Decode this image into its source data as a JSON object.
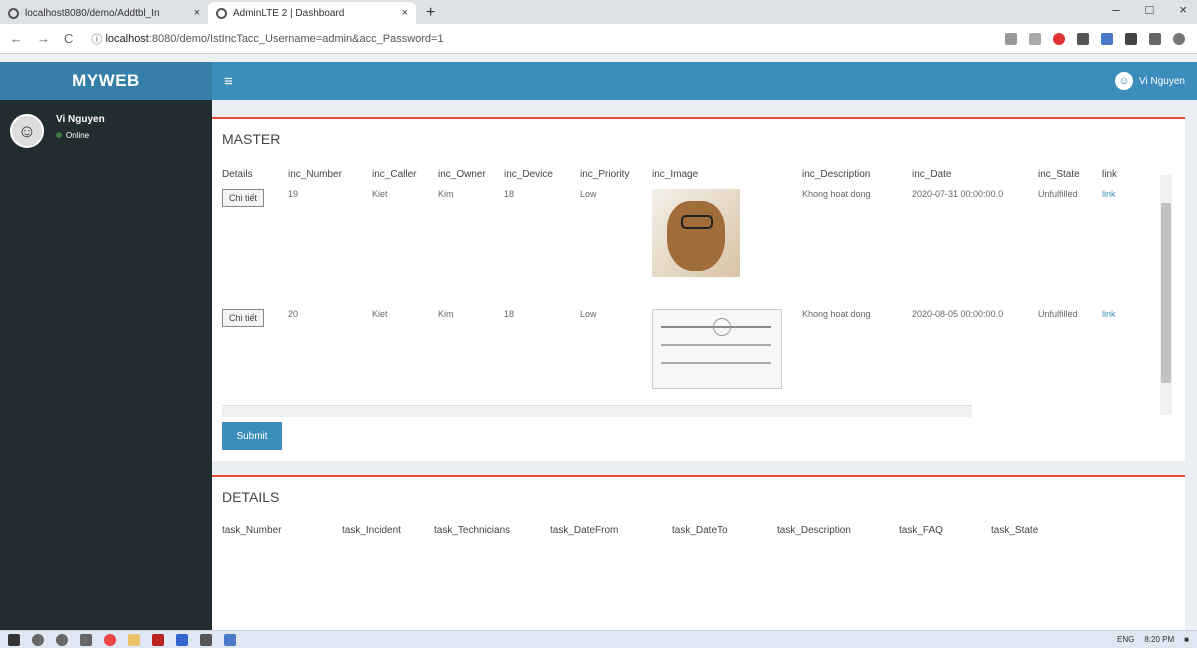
{
  "browser": {
    "tabs": [
      {
        "title": "localhost8080/demo/Addtbl_In"
      },
      {
        "title": "AdminLTE 2 | Dashboard"
      }
    ],
    "url_host": "localhost",
    "url_path": ":8080/demo/IstIncTacc_Username=admin&acc_Password=1"
  },
  "app": {
    "logo": "MYWEB",
    "user_name": "Vi Nguyen",
    "status": "Online",
    "menu_icon": "hamburger-icon"
  },
  "master": {
    "title": "MASTER",
    "columns": [
      "Details",
      "inc_Number",
      "inc_Caller",
      "inc_Owner",
      "inc_Device",
      "inc_Priority",
      "inc_Image",
      "inc_Description",
      "inc_Date",
      "inc_State",
      "link"
    ],
    "rows": [
      {
        "details": "Chi tiết",
        "number": "19",
        "caller": "Kiet",
        "owner": "Kim",
        "device": "18",
        "priority": "Low",
        "image": "portrait-photo",
        "description": "Khong hoat dong",
        "date": "2020-07-31 00:00:00.0",
        "state": "Unfulfilled",
        "link": "link"
      },
      {
        "details": "Chi tiết",
        "number": "20",
        "caller": "Kiet",
        "owner": "Kim",
        "device": "18",
        "priority": "Low",
        "image": "diagram-image",
        "description": "Khong hoat dong",
        "date": "2020-08-05 00:00:00.0",
        "state": "Unfulfilled",
        "link": "link"
      }
    ],
    "submit_label": "Submit"
  },
  "details": {
    "title": "DETAILS",
    "columns": [
      "task_Number",
      "task_Incident",
      "task_Technicians",
      "task_DateFrom",
      "task_DateTo",
      "task_Description",
      "task_FAQ",
      "task_State"
    ]
  },
  "taskbar": {
    "time": "8:20 PM",
    "language": "ENG"
  }
}
